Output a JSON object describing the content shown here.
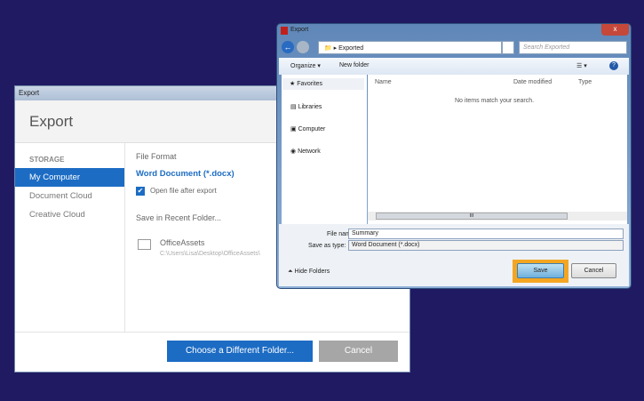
{
  "back_dialog": {
    "window_title": "Export",
    "header_title": "Export",
    "sidebar": {
      "section_label": "STORAGE",
      "items": [
        {
          "label": "My Computer",
          "selected": true
        },
        {
          "label": "Document Cloud"
        },
        {
          "label": "Creative Cloud"
        }
      ]
    },
    "file_format_label": "File Format",
    "file_format_value": "Word Document (*.docx)",
    "open_after_export_label": "Open file after export",
    "open_after_export_checked": true,
    "recent_folder_label": "Save in Recent Folder...",
    "recent_folder": {
      "name": "OfficeAssets",
      "path": "C:\\Users\\Lisa\\Desktop\\OfficeAssets\\"
    },
    "choose_folder_button": "Choose a Different Folder...",
    "cancel_button": "Cancel"
  },
  "save_dialog": {
    "window_title": "Export",
    "close_glyph": "x",
    "address": "Exported",
    "search_placeholder": "Search Exported",
    "toolbar": {
      "organize": "Organize ▾",
      "new_folder": "New folder",
      "help": "?"
    },
    "nav": [
      {
        "label": "Favorites"
      },
      {
        "label": "Libraries"
      },
      {
        "label": "Computer"
      },
      {
        "label": "Network"
      }
    ],
    "columns": [
      "Name",
      "Date modified",
      "Type"
    ],
    "empty_message": "No items match your search.",
    "file_name_label": "File name:",
    "file_name_value": "Summary",
    "save_type_label": "Save as type:",
    "save_type_value": "Word Document (*.docx)",
    "hide_folders": "Hide Folders",
    "save_button": "Save",
    "cancel_button": "Cancel",
    "scroll_grip": "III"
  },
  "colors": {
    "background": "#201a62",
    "accent": "#1c6cc4",
    "highlight": "#f4a623"
  }
}
